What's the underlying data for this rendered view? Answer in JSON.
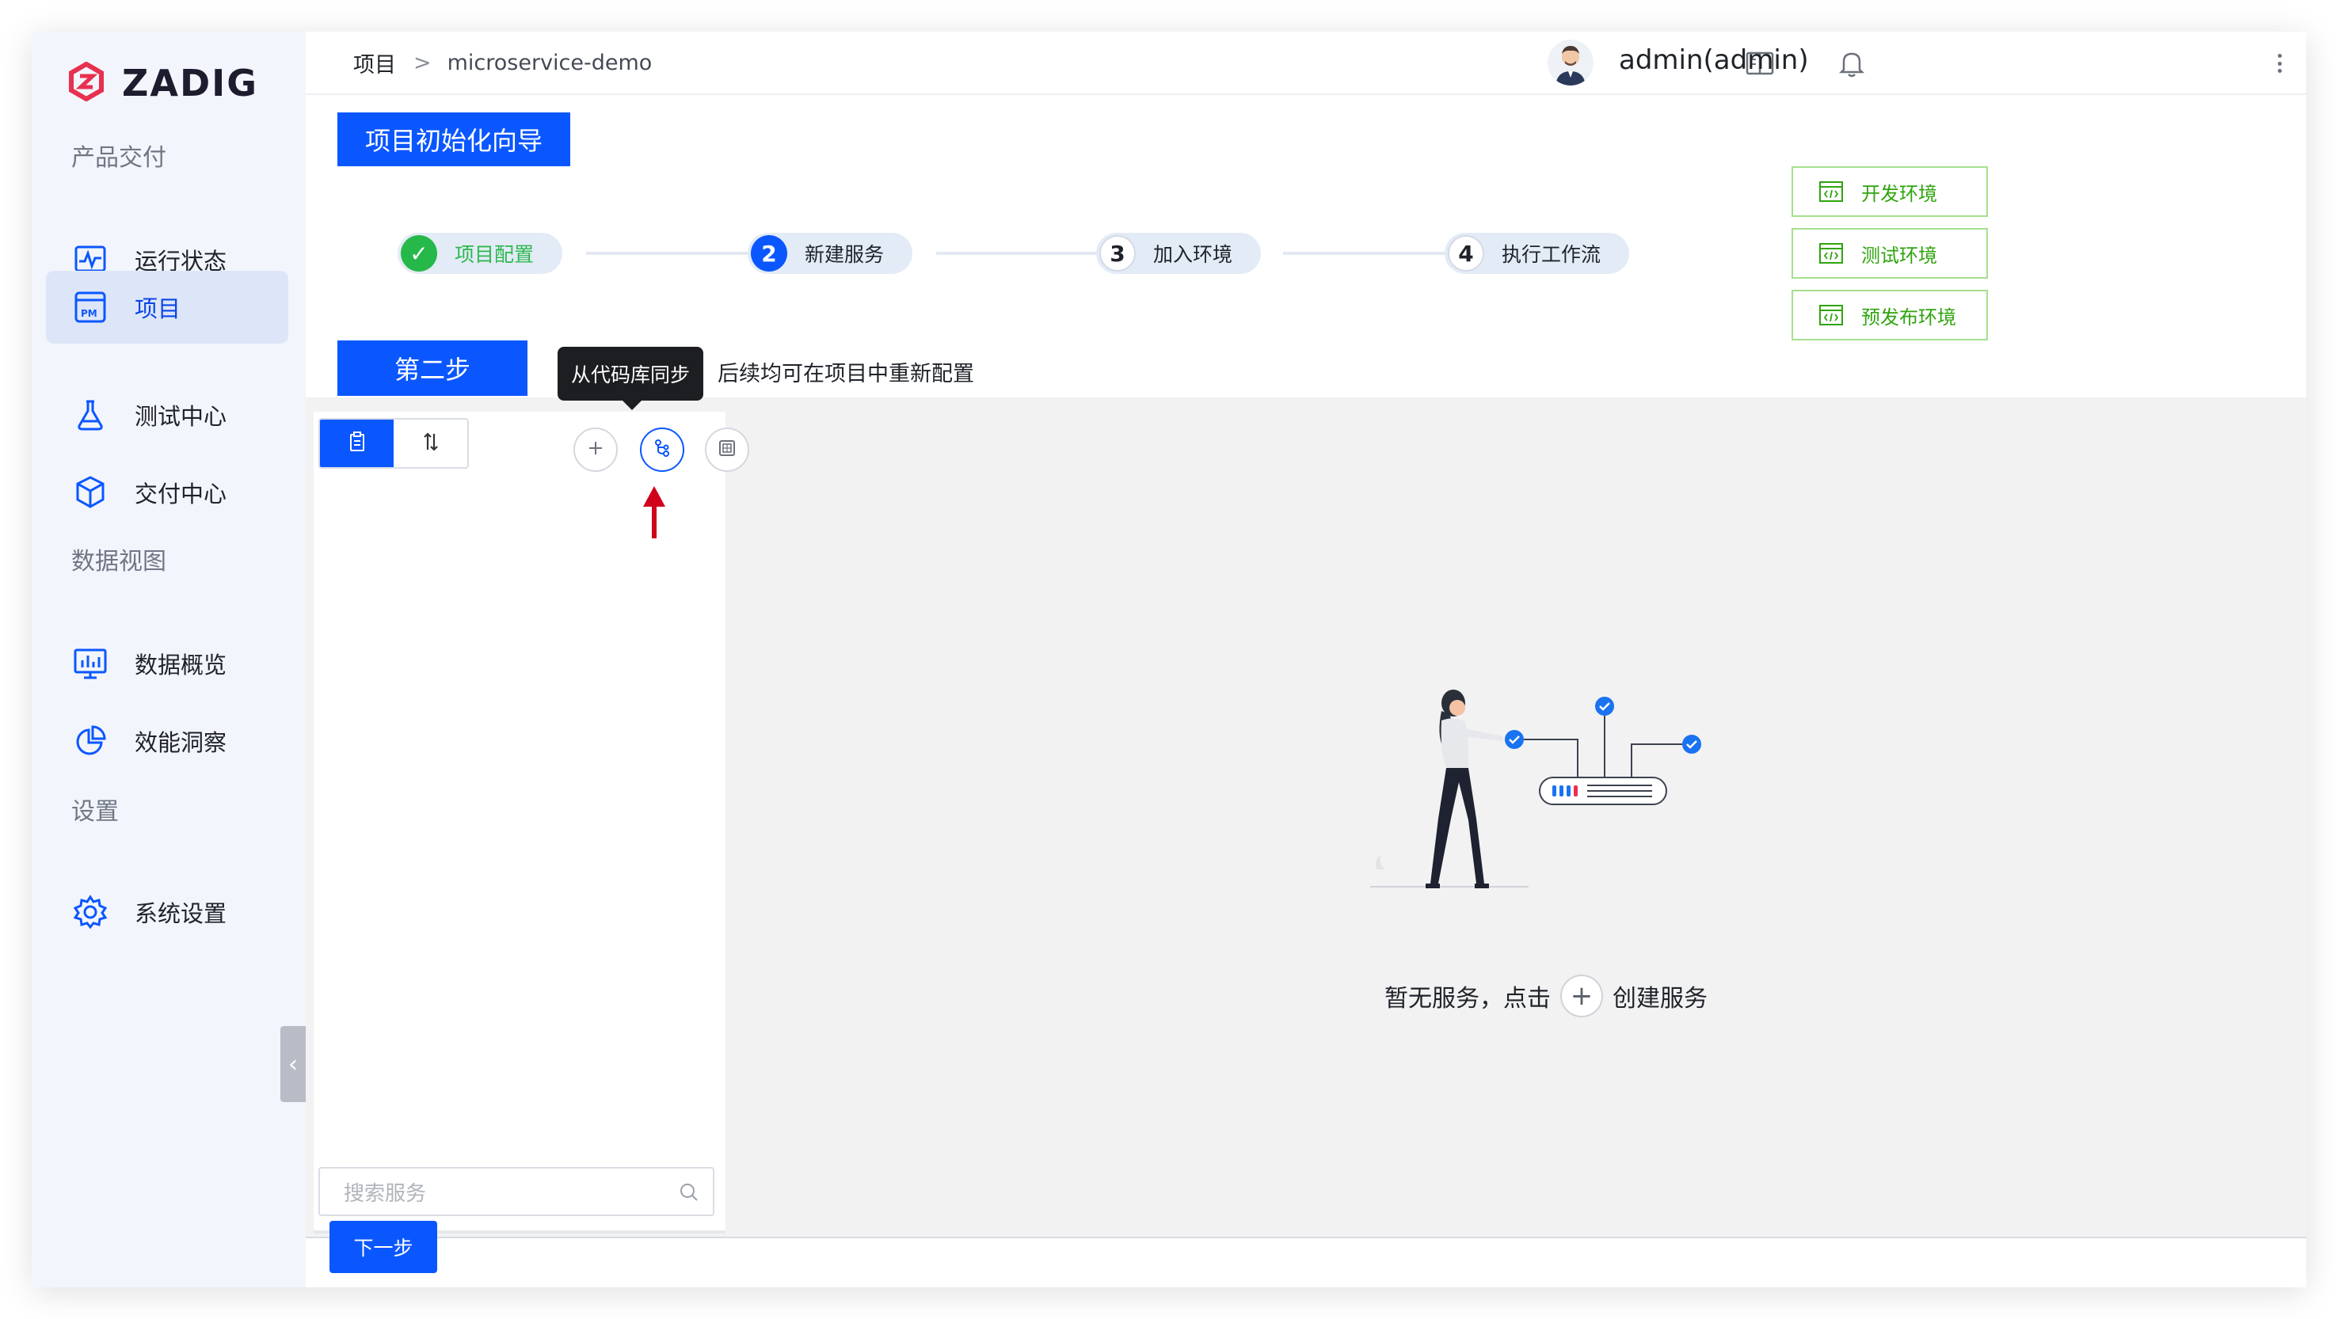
{
  "app": {
    "logo_text": "ZADIG",
    "brand_color": "#0b57ff"
  },
  "sidebar": {
    "sections": [
      {
        "title": "产品交付"
      },
      {
        "title": "数据视图"
      },
      {
        "title": "设置"
      }
    ],
    "items": [
      {
        "label": "运行状态",
        "icon": "pulse-monitor-icon"
      },
      {
        "label": "项目",
        "icon": "project-pm-icon",
        "active": true
      },
      {
        "label": "测试中心",
        "icon": "flask-icon"
      },
      {
        "label": "交付中心",
        "icon": "package-icon"
      },
      {
        "label": "数据概览",
        "icon": "dashboard-chart-icon"
      },
      {
        "label": "效能洞察",
        "icon": "pie-chart-icon"
      },
      {
        "label": "系统设置",
        "icon": "gear-icon"
      }
    ]
  },
  "header": {
    "breadcrumb_root": "项目",
    "breadcrumb_sep": ">",
    "breadcrumb_current": "microservice-demo",
    "username": "admin(admin)"
  },
  "wizard": {
    "title": "项目初始化向导",
    "steps": [
      {
        "number": "✓",
        "label": "项目配置",
        "state": "done"
      },
      {
        "number": "2",
        "label": "新建服务",
        "state": "current"
      },
      {
        "number": "3",
        "label": "加入环境",
        "state": "todo"
      },
      {
        "number": "4",
        "label": "执行工作流",
        "state": "todo"
      }
    ],
    "environments": [
      "开发环境",
      "测试环境",
      "预发布环境"
    ],
    "current_step_label": "第二步",
    "hint": "后续均可在项目中重新配置",
    "tooltip": "从代码库同步"
  },
  "service_panel": {
    "search_placeholder": "搜索服务",
    "empty_text_before": "暂无服务，点击",
    "empty_plus": "+",
    "empty_text_after": "创建服务"
  },
  "footer": {
    "next_label": "下一步"
  }
}
